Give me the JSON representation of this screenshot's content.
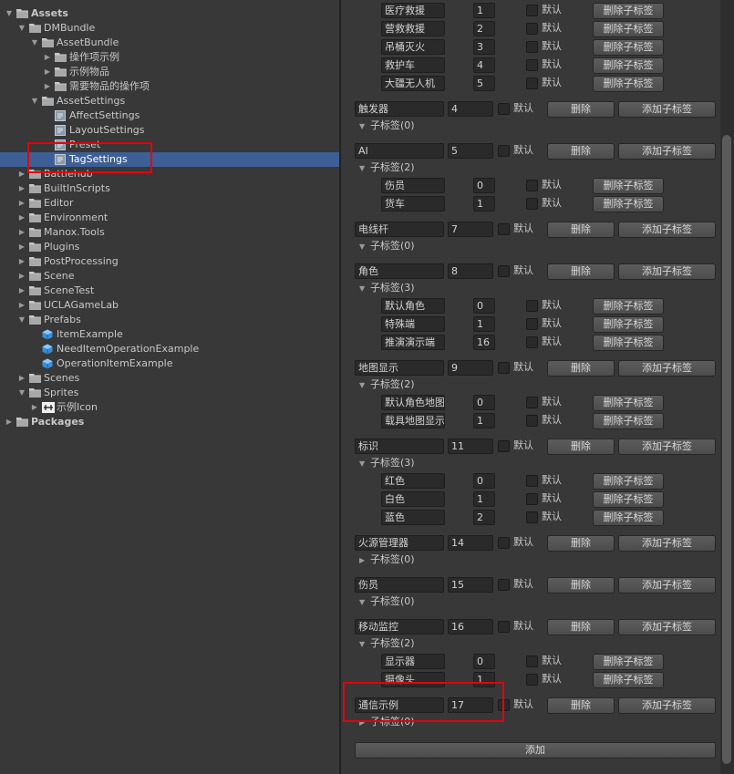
{
  "tree": {
    "rows": [
      {
        "label": "Assets",
        "icon": "folder-icon",
        "arrow": "open",
        "bold": true
      },
      {
        "label": "DMBundle",
        "icon": "folder-icon",
        "arrow": "open"
      },
      {
        "label": "AssetBundle",
        "icon": "folder-icon",
        "arrow": "open"
      },
      {
        "label": "操作项示例",
        "icon": "folder-icon",
        "arrow": "closed"
      },
      {
        "label": "示例物品",
        "icon": "folder-icon",
        "arrow": "closed"
      },
      {
        "label": "需要物品的操作项",
        "icon": "folder-icon",
        "arrow": "closed"
      },
      {
        "label": "AssetSettings",
        "icon": "folder-icon",
        "arrow": "open"
      },
      {
        "label": "AffectSettings",
        "icon": "scriptable-asset-icon",
        "arrow": "none"
      },
      {
        "label": "LayoutSettings",
        "icon": "scriptable-asset-icon",
        "arrow": "none"
      },
      {
        "label": "Preset",
        "icon": "scriptable-asset-icon",
        "arrow": "none"
      },
      {
        "label": "TagSettings",
        "icon": "scriptable-asset-icon",
        "arrow": "none",
        "selected": true
      },
      {
        "label": "Battlehub",
        "icon": "folder-icon",
        "arrow": "closed"
      },
      {
        "label": "BuiltInScripts",
        "icon": "folder-icon",
        "arrow": "closed"
      },
      {
        "label": "Editor",
        "icon": "folder-icon",
        "arrow": "closed"
      },
      {
        "label": "Environment",
        "icon": "folder-icon",
        "arrow": "closed"
      },
      {
        "label": "Manox.Tools",
        "icon": "folder-icon",
        "arrow": "closed"
      },
      {
        "label": "Plugins",
        "icon": "folder-icon",
        "arrow": "closed"
      },
      {
        "label": "PostProcessing",
        "icon": "folder-icon",
        "arrow": "closed"
      },
      {
        "label": "Scene",
        "icon": "folder-icon",
        "arrow": "closed"
      },
      {
        "label": "SceneTest",
        "icon": "folder-icon",
        "arrow": "closed"
      },
      {
        "label": "UCLAGameLab",
        "icon": "folder-icon",
        "arrow": "closed"
      },
      {
        "label": "Prefabs",
        "icon": "folder-icon",
        "arrow": "open"
      },
      {
        "label": "ItemExample",
        "icon": "prefab-icon",
        "arrow": "none"
      },
      {
        "label": "NeedItemOperationExample",
        "icon": "prefab-icon",
        "arrow": "none"
      },
      {
        "label": "OperationItemExample",
        "icon": "prefab-icon",
        "arrow": "none"
      },
      {
        "label": "Scenes",
        "icon": "folder-icon",
        "arrow": "closed"
      },
      {
        "label": "Sprites",
        "icon": "folder-icon",
        "arrow": "open"
      },
      {
        "label": "示例Icon",
        "icon": "sprite-icon",
        "arrow": "closed"
      },
      {
        "label": "Packages",
        "icon": "folder-icon",
        "arrow": "closed",
        "bold": true
      }
    ]
  },
  "inspector": {
    "default_label": "默认",
    "delete_label": "删除",
    "add_sub_label": "添加子标签",
    "delete_sub_label": "删除子标签",
    "add_label": "添加",
    "top_children": [
      {
        "name": "医疗救援",
        "id": "1"
      },
      {
        "name": "营救救援",
        "id": "2"
      },
      {
        "name": "吊桶灭火",
        "id": "3"
      },
      {
        "name": "救护车",
        "id": "4"
      },
      {
        "name": "大疆无人机",
        "id": "5"
      }
    ],
    "tags": [
      {
        "name": "触发器",
        "id": "4",
        "sub_header": "子标签(0)",
        "expanded": true,
        "children": []
      },
      {
        "name": "AI",
        "id": "5",
        "sub_header": "子标签(2)",
        "expanded": true,
        "children": [
          {
            "name": "伤员",
            "id": "0"
          },
          {
            "name": "货车",
            "id": "1"
          }
        ]
      },
      {
        "name": "电线杆",
        "id": "7",
        "sub_header": "子标签(0)",
        "expanded": true,
        "children": []
      },
      {
        "name": "角色",
        "id": "8",
        "sub_header": "子标签(3)",
        "expanded": true,
        "children": [
          {
            "name": "默认角色",
            "id": "0"
          },
          {
            "name": "特殊端",
            "id": "1"
          },
          {
            "name": "推演演示端",
            "id": "16"
          }
        ]
      },
      {
        "name": "地图显示",
        "id": "9",
        "sub_header": "子标签(2)",
        "expanded": true,
        "children": [
          {
            "name": "默认角色地图",
            "id": "0"
          },
          {
            "name": "载具地图显示",
            "id": "1"
          }
        ]
      },
      {
        "name": "标识",
        "id": "11",
        "sub_header": "子标签(3)",
        "expanded": true,
        "children": [
          {
            "name": "红色",
            "id": "0"
          },
          {
            "name": "白色",
            "id": "1"
          },
          {
            "name": "蓝色",
            "id": "2"
          }
        ]
      },
      {
        "name": "火源管理器",
        "id": "14",
        "sub_header": "子标签(0)",
        "expanded": false,
        "children": []
      },
      {
        "name": "伤员",
        "id": "15",
        "sub_header": "子标签(0)",
        "expanded": true,
        "children": []
      },
      {
        "name": "移动监控",
        "id": "16",
        "sub_header": "子标签(2)",
        "expanded": true,
        "children": [
          {
            "name": "显示器",
            "id": "0"
          },
          {
            "name": "摄像头",
            "id": "1"
          }
        ]
      },
      {
        "name": "通信示例",
        "id": "17",
        "sub_header": "子标签(0)",
        "expanded": false,
        "children": []
      }
    ]
  },
  "colors": {
    "selection": "#3e5f96",
    "highlight_box": "#e5000b",
    "panel_bg": "#383838"
  }
}
